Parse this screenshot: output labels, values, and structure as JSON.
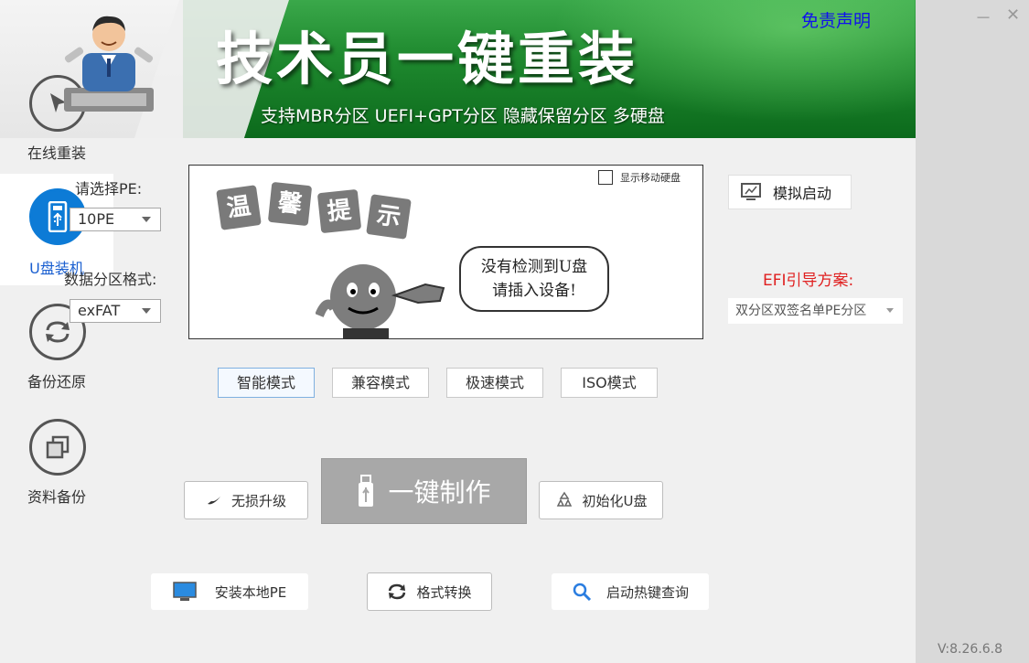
{
  "header": {
    "title": "技术员一键重装",
    "subtitle": "支持MBR分区 UEFI+GPT分区 隐藏保留分区 多硬盘",
    "disclaimer": "免责声明"
  },
  "window": {
    "minimize": "－",
    "close": "✕"
  },
  "sidebar": {
    "items": [
      {
        "label": "在线重装",
        "icon": "cursor-arrow-icon",
        "active": false
      },
      {
        "label": "U盘装机",
        "icon": "usb-drive-icon",
        "active": true
      },
      {
        "label": "备份还原",
        "icon": "refresh-arrows-icon",
        "active": false
      },
      {
        "label": "资料备份",
        "icon": "copy-squares-icon",
        "active": false
      }
    ],
    "version": "V:8.26.6.8"
  },
  "pe": {
    "label": "请选择PE:",
    "value": "10PE"
  },
  "format": {
    "label": "数据分区格式:",
    "value": "exFAT"
  },
  "info": {
    "show_removable": "显示移动硬盘",
    "tip_chars": [
      "温",
      "馨",
      "提",
      "示"
    ],
    "message_line1": "没有检测到U盘",
    "message_line2": "请插入设备!"
  },
  "modes": [
    {
      "label": "智能模式",
      "active": true
    },
    {
      "label": "兼容模式",
      "active": false
    },
    {
      "label": "极速模式",
      "active": false
    },
    {
      "label": "ISO模式",
      "active": false
    }
  ],
  "simulate": {
    "label": "模拟启动",
    "icon": "monitor-icon"
  },
  "efi": {
    "label": "EFI引导方案:",
    "value": "双分区双签名单PE分区"
  },
  "actions": {
    "upgrade": "无损升级",
    "make": "一键制作",
    "init_usb": "初始化U盘",
    "install_local_pe": "安装本地PE",
    "convert_format": "格式转换",
    "hotkey_query": "启动热键查询"
  },
  "colors": {
    "header_green": "#1f8a2f",
    "active_blue": "#0d7bd6",
    "efi_red": "#e02020",
    "disclaimer_blue": "#1010ee"
  }
}
